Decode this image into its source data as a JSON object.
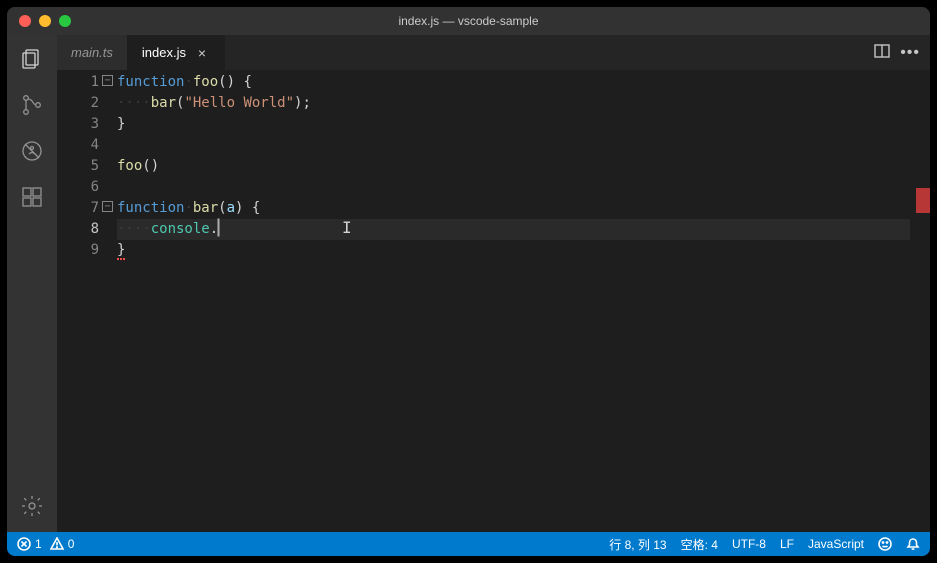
{
  "window": {
    "title": "index.js — vscode-sample"
  },
  "tabs": [
    {
      "label": "main.ts",
      "active": false
    },
    {
      "label": "index.js",
      "active": true
    }
  ],
  "code": {
    "lines": {
      "l1": {
        "kw": "function",
        "fn": "foo",
        "tail": "() {"
      },
      "l2": {
        "fn": "bar",
        "open": "(",
        "str": "\"Hello World\"",
        "close": ");"
      },
      "l3": {
        "brace": "}"
      },
      "l5": {
        "fn": "foo",
        "call": "()"
      },
      "l7": {
        "kw": "function",
        "fn": "bar",
        "open": "(",
        "arg": "a",
        "close": ") {"
      },
      "l8": {
        "obj": "console",
        "dot": "."
      },
      "l9": {
        "brace": "}"
      }
    },
    "line_count": 9,
    "current_line": 8
  },
  "status": {
    "errors": "1",
    "warnings": "0",
    "linecol": "行 8, 列 13",
    "spaces": "空格: 4",
    "encoding": "UTF-8",
    "eol": "LF",
    "language": "JavaScript"
  }
}
